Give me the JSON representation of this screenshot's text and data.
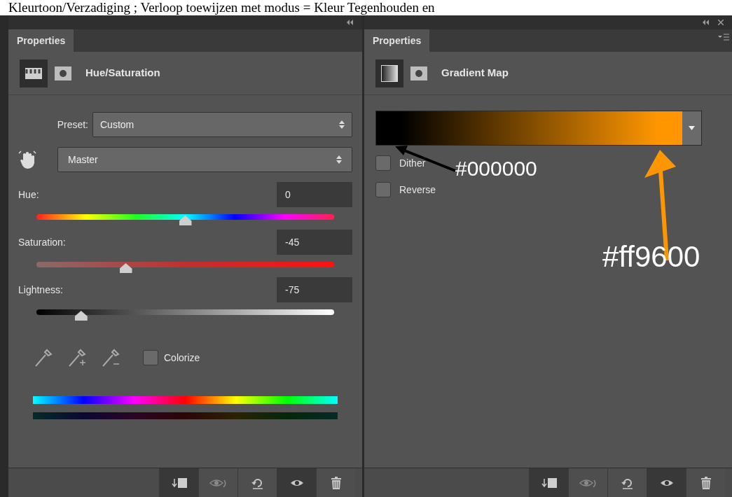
{
  "caption": "Kleurtoon/Verzadiging ; Verloop toewijzen met modus = Kleur Tegenhouden en",
  "hue_saturation_panel": {
    "tab": {
      "label": "Properties",
      "selected": true
    },
    "title": "Hue/Saturation",
    "preset": {
      "label": "Preset:",
      "value": "Custom"
    },
    "channel": {
      "value": "Master"
    },
    "sliders": [
      {
        "kind": "hue",
        "label": "Hue:",
        "value": "0",
        "level": 0.5
      },
      {
        "kind": "saturation",
        "label": "Saturation:",
        "value": "-45",
        "level": 0.3
      },
      {
        "kind": "lightness",
        "label": "Lightness:",
        "value": "-75",
        "level": 0.15
      }
    ],
    "colorize": {
      "label": "Colorize",
      "checked": false
    },
    "footer": [
      {
        "kind": "clip",
        "selected": true
      },
      {
        "kind": "previous",
        "selected": false
      },
      {
        "kind": "reset",
        "selected": false
      },
      {
        "kind": "visibility",
        "selected": true
      },
      {
        "kind": "delete",
        "selected": false
      }
    ]
  },
  "gradient_map_panel": {
    "tab": {
      "label": "Properties",
      "selected": true
    },
    "title": "Gradient Map",
    "gradient": {
      "stops": [
        {
          "color": "#000000",
          "label": "#000000"
        },
        {
          "color": "#ff9600",
          "label": "#ff9600"
        }
      ]
    },
    "options": [
      {
        "label": "Dither",
        "checked": false
      },
      {
        "label": "Reverse",
        "checked": false
      }
    ],
    "footer": [
      {
        "kind": "clip",
        "selected": true
      },
      {
        "kind": "previous",
        "selected": false
      },
      {
        "kind": "reset",
        "selected": false
      },
      {
        "kind": "visibility",
        "selected": true
      },
      {
        "kind": "delete",
        "selected": false
      }
    ]
  }
}
